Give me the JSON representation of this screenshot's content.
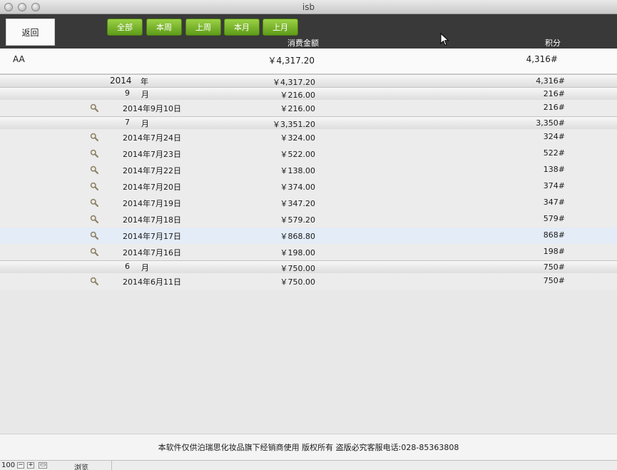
{
  "window": {
    "title": "isb"
  },
  "toolbar": {
    "back_label": "返回",
    "filters": [
      "全部",
      "本周",
      "上周",
      "本月",
      "上月"
    ],
    "col_amount": "消费金额",
    "col_points": "积分"
  },
  "summary": {
    "name": "AA",
    "amount": "￥4,317.20",
    "points": "4,316#"
  },
  "rows": [
    {
      "kind": "year",
      "label": "2014",
      "unit": "年",
      "amount": "￥4,317.20",
      "points": "4,316#"
    },
    {
      "kind": "month",
      "label": "9",
      "unit": "月",
      "amount": "￥216.00",
      "points": "216#"
    },
    {
      "kind": "day",
      "label": "2014年9月10日",
      "amount": "￥216.00",
      "points": "216#"
    },
    {
      "kind": "month",
      "label": "7",
      "unit": "月",
      "amount": "￥3,351.20",
      "points": "3,350#"
    },
    {
      "kind": "day",
      "label": "2014年7月24日",
      "amount": "￥324.00",
      "points": "324#"
    },
    {
      "kind": "day",
      "label": "2014年7月23日",
      "amount": "￥522.00",
      "points": "522#"
    },
    {
      "kind": "day",
      "label": "2014年7月22日",
      "amount": "￥138.00",
      "points": "138#"
    },
    {
      "kind": "day",
      "label": "2014年7月20日",
      "amount": "￥374.00",
      "points": "374#"
    },
    {
      "kind": "day",
      "label": "2014年7月19日",
      "amount": "￥347.20",
      "points": "347#"
    },
    {
      "kind": "day",
      "label": "2014年7月18日",
      "amount": "￥579.20",
      "points": "579#"
    },
    {
      "kind": "day",
      "label": "2014年7月17日",
      "amount": "￥868.80",
      "points": "868#",
      "highlight": true
    },
    {
      "kind": "day",
      "label": "2014年7月16日",
      "amount": "￥198.00",
      "points": "198#"
    },
    {
      "kind": "month",
      "label": "6",
      "unit": "月",
      "amount": "￥750.00",
      "points": "750#"
    },
    {
      "kind": "day",
      "label": "2014年6月11日",
      "amount": "￥750.00",
      "points": "750#"
    }
  ],
  "footer": {
    "notice": "本软件仅供泊瑞思化妆品旗下经销商使用 版权所有 盗版必究客服电话:028-85363808"
  },
  "status": {
    "zoom": "100",
    "mode": "浏览"
  },
  "colors": {
    "accent_green": "#7cb82f",
    "toolbar_bg": "#393939",
    "highlight_row": "#e3ecf7"
  }
}
